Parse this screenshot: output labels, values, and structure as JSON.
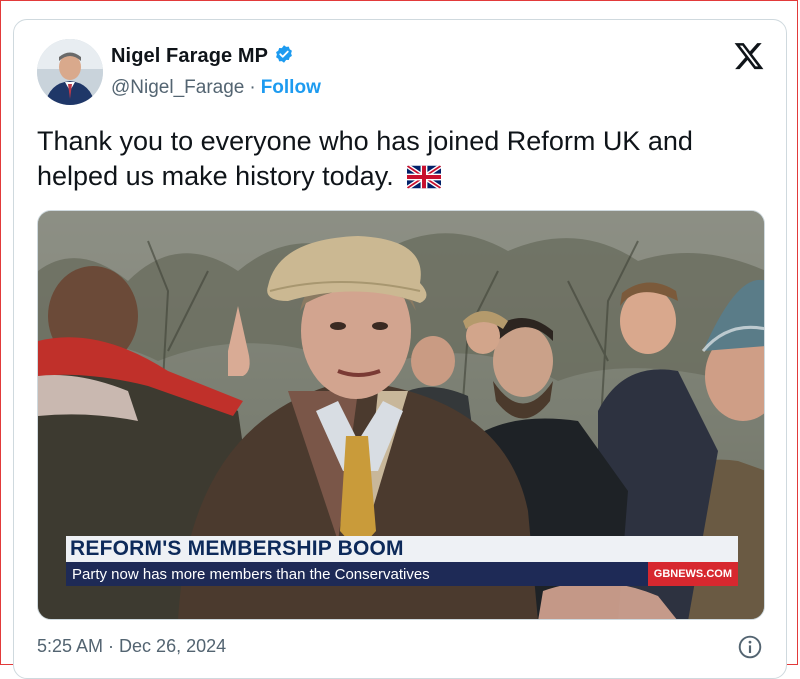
{
  "tweet": {
    "author": {
      "display_name": "Nigel Farage MP",
      "handle": "@Nigel_Farage",
      "verified_icon": "verified-badge-icon",
      "separator": "·",
      "follow_label": "Follow"
    },
    "text": "Thank you to everyone who has joined Reform UK and helped us make history today.",
    "emoji": "union-jack-flag",
    "media": {
      "headline": "REFORM'S MEMBERSHIP BOOM",
      "subline": "Party now has more members than the Conservatives",
      "network": "GBNEWS.COM"
    },
    "time": "5:25 AM",
    "time_separator": "·",
    "date": "Dec 26, 2024"
  },
  "icons": {
    "platform_logo": "x-logo-icon",
    "info": "info-icon"
  },
  "colors": {
    "accent": "#1d9bf0",
    "text": "#0f1419",
    "secondary_text": "#536471",
    "border": "#cfd9de",
    "outer_border": "#e23a3a",
    "headline_bg": "#eef1f5",
    "headline_text": "#0d2a5a",
    "subline_bg": "#1e2a56",
    "network_badge": "#d7282f"
  }
}
